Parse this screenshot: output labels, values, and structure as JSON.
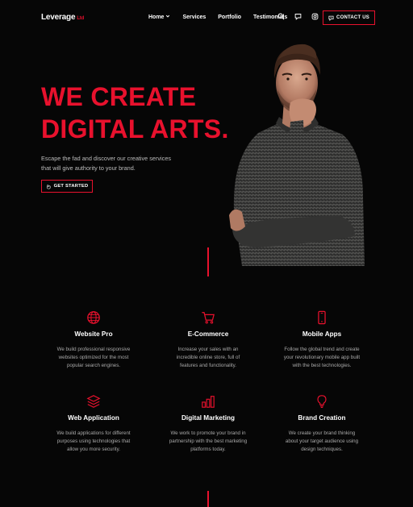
{
  "brand": {
    "name": "Leverage",
    "suffix": "Ltd"
  },
  "nav": {
    "items": [
      {
        "label": "Home",
        "has_dropdown": true
      },
      {
        "label": "Services"
      },
      {
        "label": "Portfolio"
      },
      {
        "label": "Testimonials"
      }
    ],
    "icons": [
      "search-icon",
      "chat-icon",
      "instagram-icon"
    ],
    "contact_label": "CONTACT US"
  },
  "hero": {
    "headline_line1": "WE CREATE",
    "headline_line2": "DIGITAL ARTS.",
    "tagline_line1": "Escape the fad and discover our creative services",
    "tagline_line2": "that will give authority to your brand.",
    "cta_label": "GET STARTED"
  },
  "services": [
    {
      "icon": "globe-icon",
      "title": "Website Pro",
      "desc": [
        "We build professional responsive",
        "websites optimized for the most",
        "popular search engines."
      ]
    },
    {
      "icon": "cart-icon",
      "title": "E-Commerce",
      "desc": [
        "Increase your sales with an",
        "incredible online store, full of",
        "features and functionality."
      ]
    },
    {
      "icon": "mobile-icon",
      "title": "Mobile Apps",
      "desc": [
        "Follow the global trend and create",
        "your revolutionary mobile app built",
        "with the best technologies."
      ]
    },
    {
      "icon": "layers-icon",
      "title": "Web Application",
      "desc": [
        "We build applications for different",
        "purposes using technologies that",
        "allow you more security."
      ]
    },
    {
      "icon": "bar-chart-icon",
      "title": "Digital Marketing",
      "desc": [
        "We work to promote your brand in",
        "partnership with the best marketing",
        "platforms today."
      ]
    },
    {
      "icon": "lightbulb-icon",
      "title": "Brand Creation",
      "desc": [
        "We create your brand thinking",
        "about your target audience using",
        "design techniques."
      ]
    }
  ],
  "colors": {
    "accent": "#e8112d",
    "background": "#060606",
    "text_muted": "#a9a9a9"
  }
}
